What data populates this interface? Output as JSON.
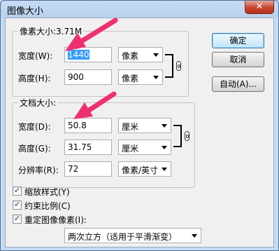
{
  "window": {
    "title": "图像大小",
    "close_glyph": "✕"
  },
  "pixel_dimensions": {
    "legend": "像素大小:3.71M",
    "width_label": "宽度(W):",
    "width_value": "1440",
    "width_unit": "像素",
    "height_label": "高度(H):",
    "height_value": "900",
    "height_unit": "像素"
  },
  "document_size": {
    "legend": "文档大小:",
    "width_label": "宽度(D):",
    "width_value": "50.8",
    "width_unit": "厘米",
    "height_label": "高度(G):",
    "height_value": "31.75",
    "height_unit": "厘米",
    "resolution_label": "分辨率(R):",
    "resolution_value": "72",
    "resolution_unit": "像素/英寸"
  },
  "buttons": {
    "ok": "确定",
    "cancel": "取消",
    "auto": "自动(A)..."
  },
  "options": {
    "scale_styles": "缩放样式(Y)",
    "constrain_proportions": "约束比例(C)",
    "resample": "重定图像像素(I):",
    "resample_method": "两次立方（适用于平滑渐变）",
    "check_glyph": "✓"
  },
  "colors": {
    "annotation_arrow": "#f0306e",
    "selection": "#3399ff"
  }
}
